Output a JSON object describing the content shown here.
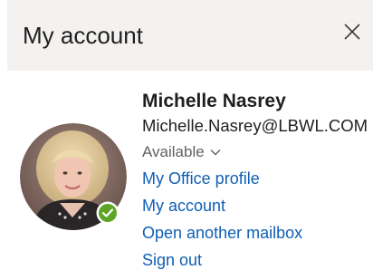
{
  "header": {
    "title": "My account"
  },
  "user": {
    "name": "Michelle Nasrey",
    "email": "Michelle.Nasrey@LBWL.COM",
    "status": "Available",
    "presence_color": "#5ea527"
  },
  "links": {
    "office_profile": "My Office profile",
    "my_account": "My account",
    "open_mailbox": "Open another mailbox",
    "sign_out": "Sign out"
  },
  "colors": {
    "header_bg": "#f4f2f0",
    "link": "#0f5fb5",
    "text": "#1f1f1f",
    "muted": "#616161"
  },
  "icons": {
    "close": "close-icon",
    "chevron": "chevron-down-icon",
    "presence": "checkmark-icon"
  }
}
